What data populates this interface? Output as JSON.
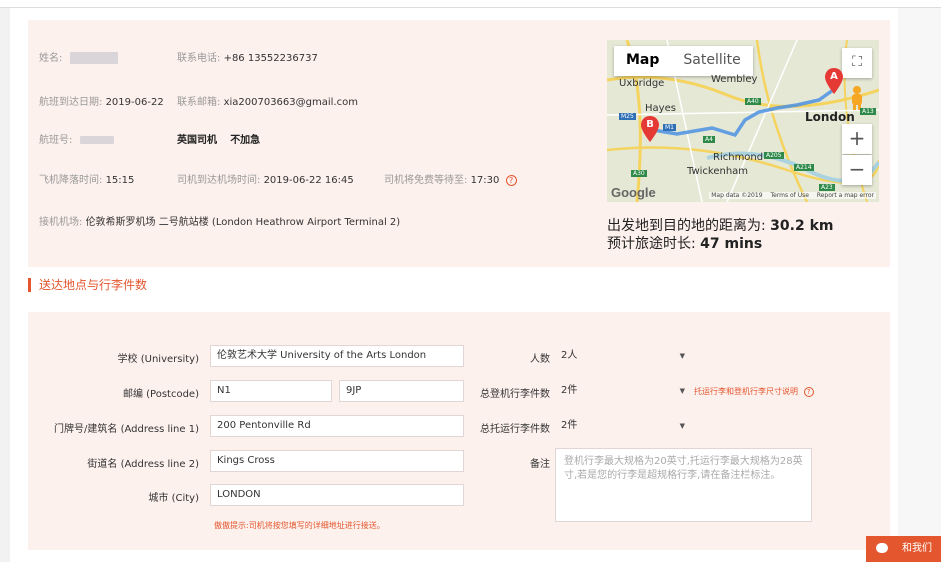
{
  "order": {
    "name_label": "姓名:",
    "phone_label": "联系电话:",
    "phone_value": "+86 13552236737",
    "arrival_date_label": "航班到达日期:",
    "arrival_date_value": "2019-06-22",
    "email_label": "联系邮箱:",
    "email_value": "xia200703663@gmail.com",
    "flight_label": "航班号:",
    "driver_type": "英国司机",
    "urgent": "不加急",
    "landing_label": "飞机降落时间:",
    "landing_value": "15:15",
    "driver_arrive_label": "司机到达机场时间:",
    "driver_arrive_value": "2019-06-22 16:45",
    "wait_label": "司机将免费等待至:",
    "wait_value": "17:30",
    "airport_label": "接机机场:",
    "airport_value": "伦敦希斯罗机场 二号航站楼 (London Heathrow Airport Terminal 2)"
  },
  "map": {
    "tab_map": "Map",
    "tab_satellite": "Satellite",
    "labels": [
      "Uxbridge",
      "Wembley",
      "Hayes",
      "London",
      "Richmond",
      "Twickenham"
    ],
    "shields": [
      "M25",
      "A40",
      "A13",
      "A4",
      "A205",
      "A214",
      "A30",
      "A23",
      "M1"
    ],
    "marker_a": "A",
    "marker_b": "B",
    "zoom_in": "+",
    "zoom_out": "−",
    "google": "Google",
    "map_data": "Map data ©2019",
    "terms": "Terms of Use",
    "report": "Report a map error"
  },
  "summary": {
    "distance_label": "出发地到目的地的距离为:",
    "distance_value": "30.2 km",
    "duration_label": "预计旅途时长:",
    "duration_value": "47 mins"
  },
  "section": {
    "title": "送达地点与行李件数"
  },
  "form": {
    "school_label": "学校 (University)",
    "school_value": "伦敦艺术大学 University of the Arts London",
    "postcode_label": "邮编 (Postcode)",
    "postcode_1": "N1",
    "postcode_2": "9JP",
    "address1_label": "门牌号/建筑名 (Address line 1)",
    "address1_value": "200 Pentonville Rd",
    "address2_label": "街道名 (Address line 2)",
    "address2_value": "Kings Cross",
    "city_label": "城市 (City)",
    "city_value": "LONDON",
    "tip": "傲傲提示:司机将按您填写的详细地址进行接送。",
    "people_label": "人数",
    "people_value": "2人",
    "checked_label": "总登机行李件数",
    "checked_value": "2件",
    "luggage_link": "托运行李和登机行李尺寸说明",
    "consigned_label": "总托运行李件数",
    "consigned_value": "2件",
    "note_label": "备注",
    "note_placeholder": "登机行李最大规格为20英寸,托运行李最大规格为28英寸,若是您的行李是超规格行李,请在备注栏标注。"
  },
  "chat": {
    "label": "和我们"
  },
  "colors": {
    "accent": "#e4572e",
    "card_bg": "#fdf1ee"
  }
}
